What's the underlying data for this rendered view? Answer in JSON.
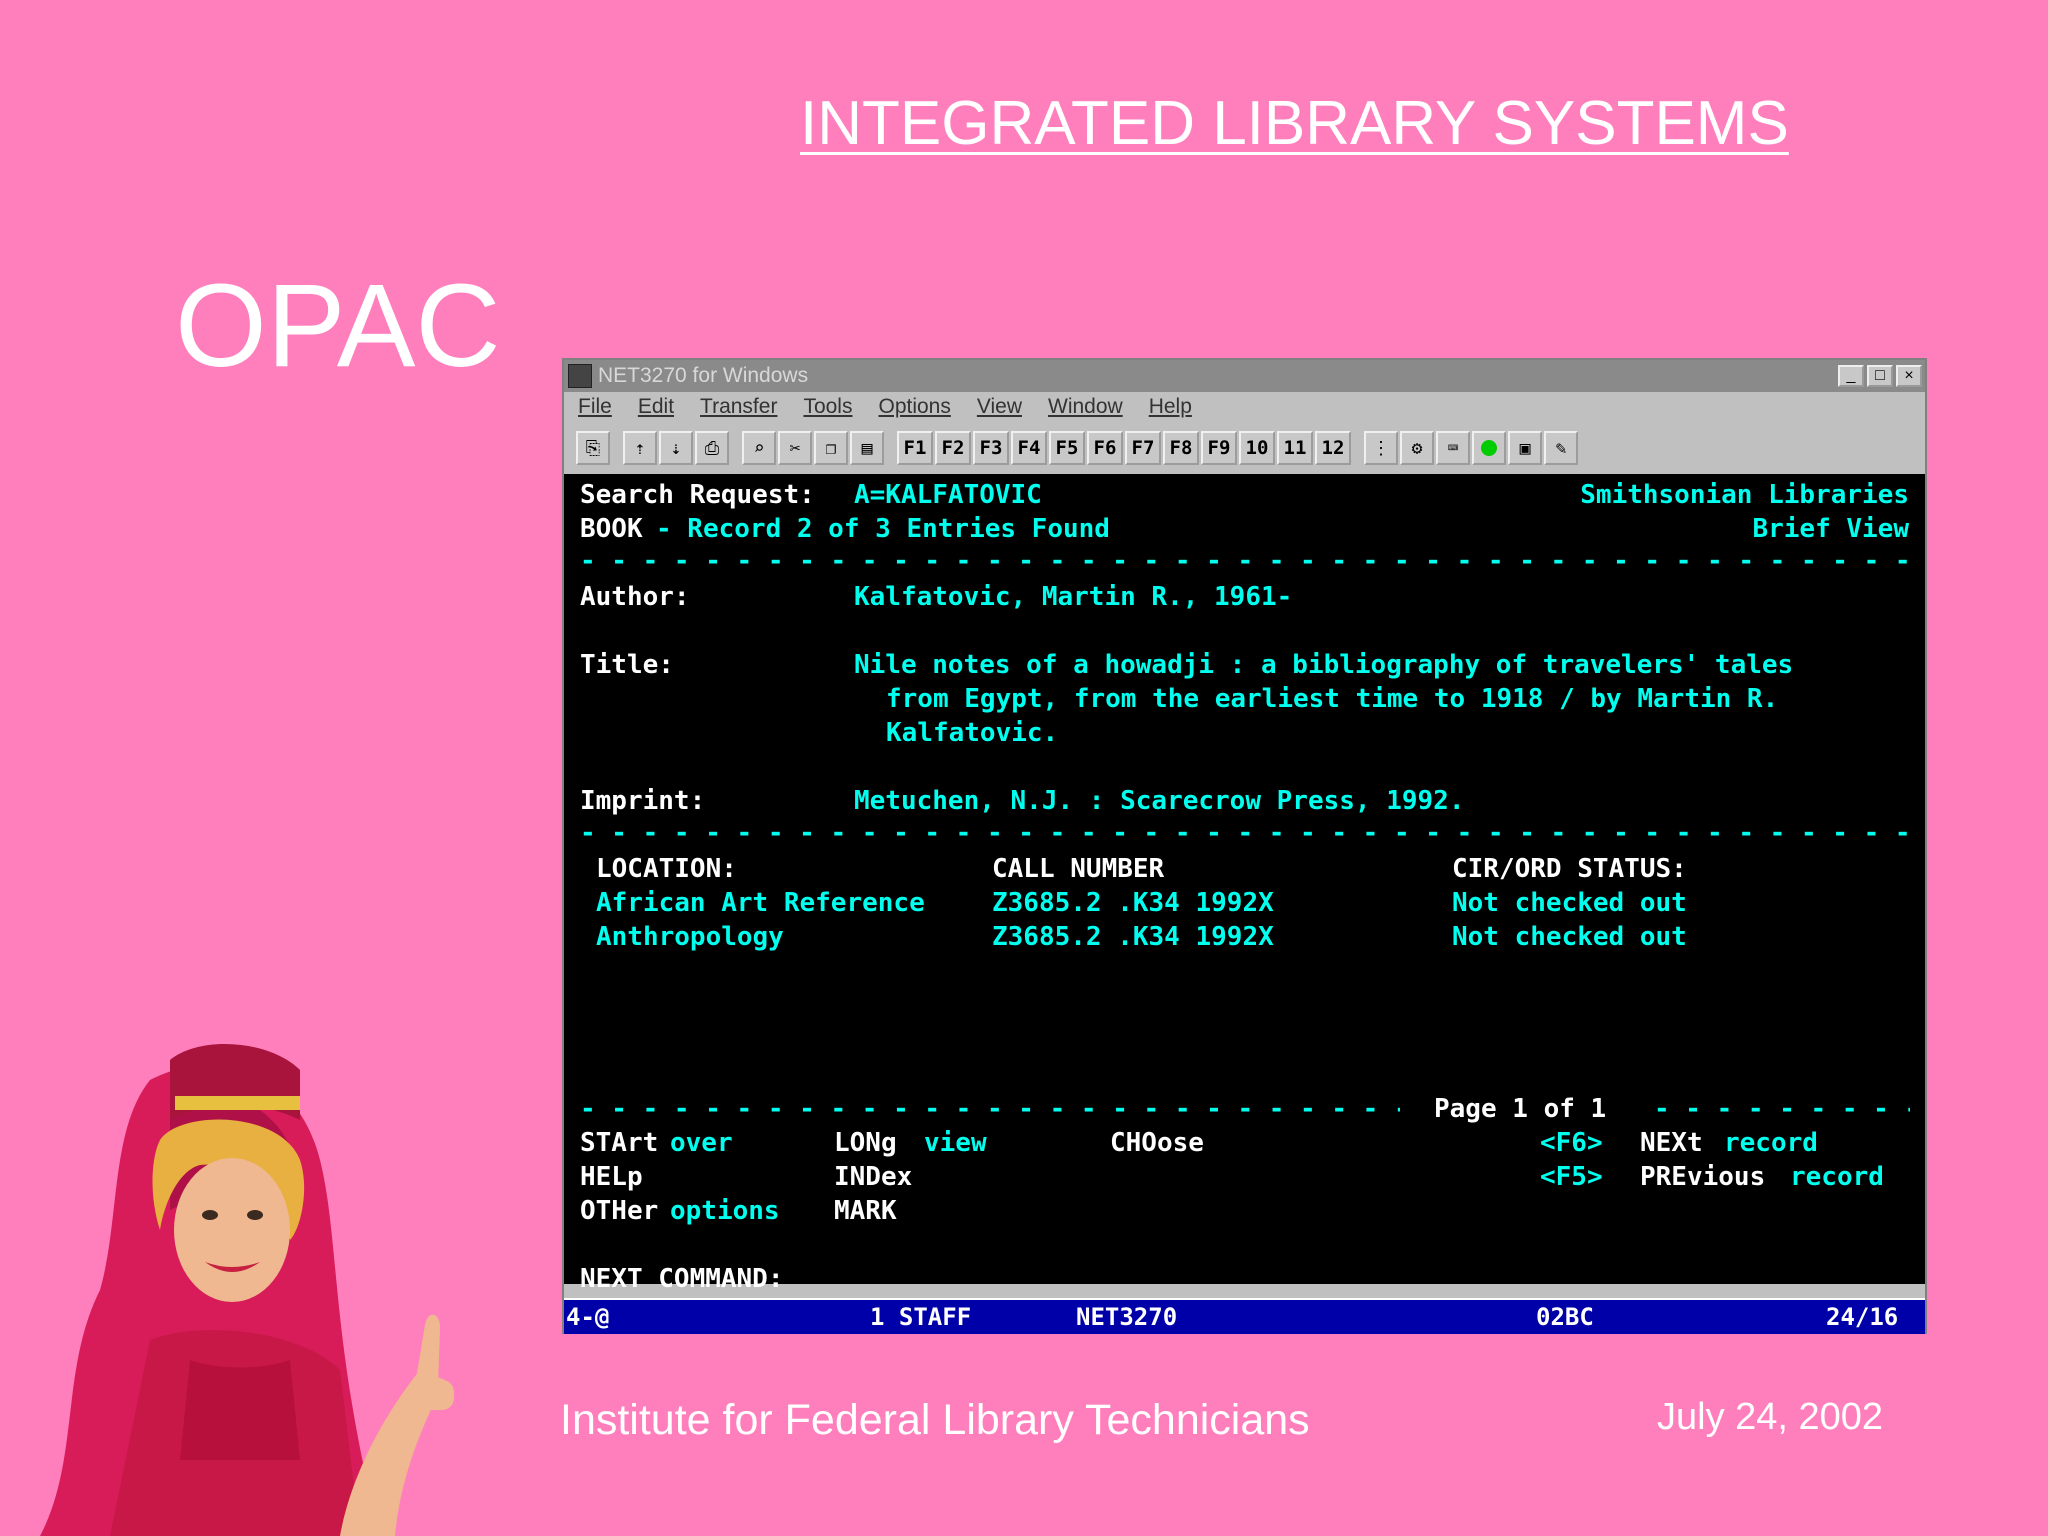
{
  "slide": {
    "title": "INTEGRATED LIBRARY SYSTEMS",
    "heading": "OPAC",
    "footer_left": "Institute for Federal Library Technicians",
    "footer_right": "July 24, 2002"
  },
  "window": {
    "title": "NET3270 for Windows",
    "menu": [
      "File",
      "Edit",
      "Transfer",
      "Tools",
      "Options",
      "View",
      "Window",
      "Help"
    ],
    "fkeys": [
      "F1",
      "F2",
      "F3",
      "F4",
      "F5",
      "F6",
      "F7",
      "F8",
      "F9",
      "10",
      "11",
      "12"
    ]
  },
  "screen": {
    "search_label": "Search Request:",
    "search_value": "A=KALFATOVIC",
    "library": "Smithsonian Libraries",
    "book_label": "BOOK",
    "record_info": "- Record 2 of 3 Entries Found",
    "view_mode": "Brief View",
    "author_label": "Author:",
    "author_value": "Kalfatovic, Martin R., 1961-",
    "title_label": "Title:",
    "title_line1": "Nile notes of a howadji : a bibliography of travelers' tales",
    "title_line2": "from Egypt, from the earliest time to 1918 / by Martin R.",
    "title_line3": "Kalfatovic.",
    "imprint_label": "Imprint:",
    "imprint_value": "Metuchen, N.J. : Scarecrow Press, 1992.",
    "col_location": "LOCATION:",
    "col_call": "CALL NUMBER",
    "col_status": "CIR/ORD STATUS:",
    "holdings": [
      {
        "location": "African Art Reference",
        "call": "Z3685.2 .K34 1992X",
        "status": "Not checked out"
      },
      {
        "location": "Anthropology",
        "call": "Z3685.2 .K34 1992X",
        "status": "Not checked out"
      }
    ],
    "page_info": "Page 1 of 1",
    "cmd_start_a": "STArt",
    "cmd_start_b": "over",
    "cmd_long_a": "LONg",
    "cmd_long_b": "view",
    "cmd_choose": "CHOose",
    "cmd_f6": "<F6>",
    "cmd_next_a": "NEXt",
    "cmd_next_b": "record",
    "cmd_help": "HELp",
    "cmd_index": "INDex",
    "cmd_f5": "<F5>",
    "cmd_prev_a": "PREvious",
    "cmd_prev_b": "record",
    "cmd_other_a": "OTHer",
    "cmd_other_b": "options",
    "cmd_mark": "MARK",
    "next_command": "NEXT COMMAND:"
  },
  "status": {
    "s1": "4-@",
    "s2": "1 STAFF",
    "s3": "NET3270",
    "s4": "02BC",
    "s5": "24/16"
  }
}
